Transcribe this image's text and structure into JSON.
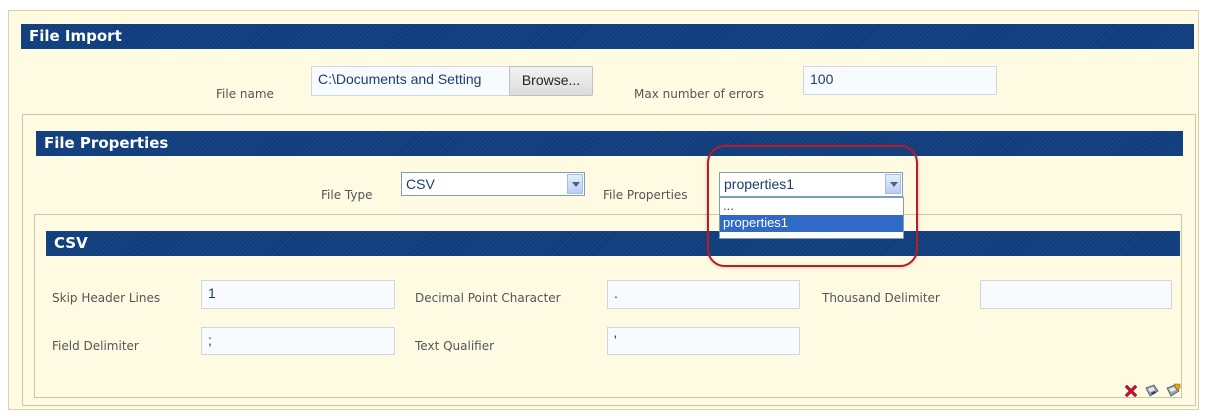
{
  "file_import": {
    "title": "File Import",
    "file_name_label": "File name",
    "file_name_value": "C:\\Documents and Setting",
    "browse_label": "Browse...",
    "max_errors_label": "Max number of errors",
    "max_errors_value": "100"
  },
  "file_properties": {
    "title": "File Properties",
    "file_type_label": "File Type",
    "file_type_value": "CSV",
    "file_properties_label": "File Properties",
    "file_properties_value": "properties1",
    "dropdown_options": [
      "...",
      "properties1"
    ],
    "selected_option_index": 1
  },
  "csv": {
    "title": "CSV",
    "skip_header_lines_label": "Skip Header Lines",
    "skip_header_lines_value": "1",
    "decimal_point_label": "Decimal Point Character",
    "decimal_point_value": ".",
    "thousand_delimiter_label": "Thousand Delimiter",
    "thousand_delimiter_value": "",
    "field_delimiter_label": "Field Delimiter",
    "field_delimiter_value": ";",
    "text_qualifier_label": "Text Qualifier",
    "text_qualifier_value": "'"
  },
  "actions": {
    "icons": [
      "close-icon",
      "save-icon",
      "save-as-icon"
    ]
  },
  "colors": {
    "header_bg": "#0f3d7c",
    "panel_bg": "#fefbe2",
    "highlight_ring": "#b21e2b",
    "selected_option": "#3169c6",
    "close_red": "#c8102e"
  }
}
